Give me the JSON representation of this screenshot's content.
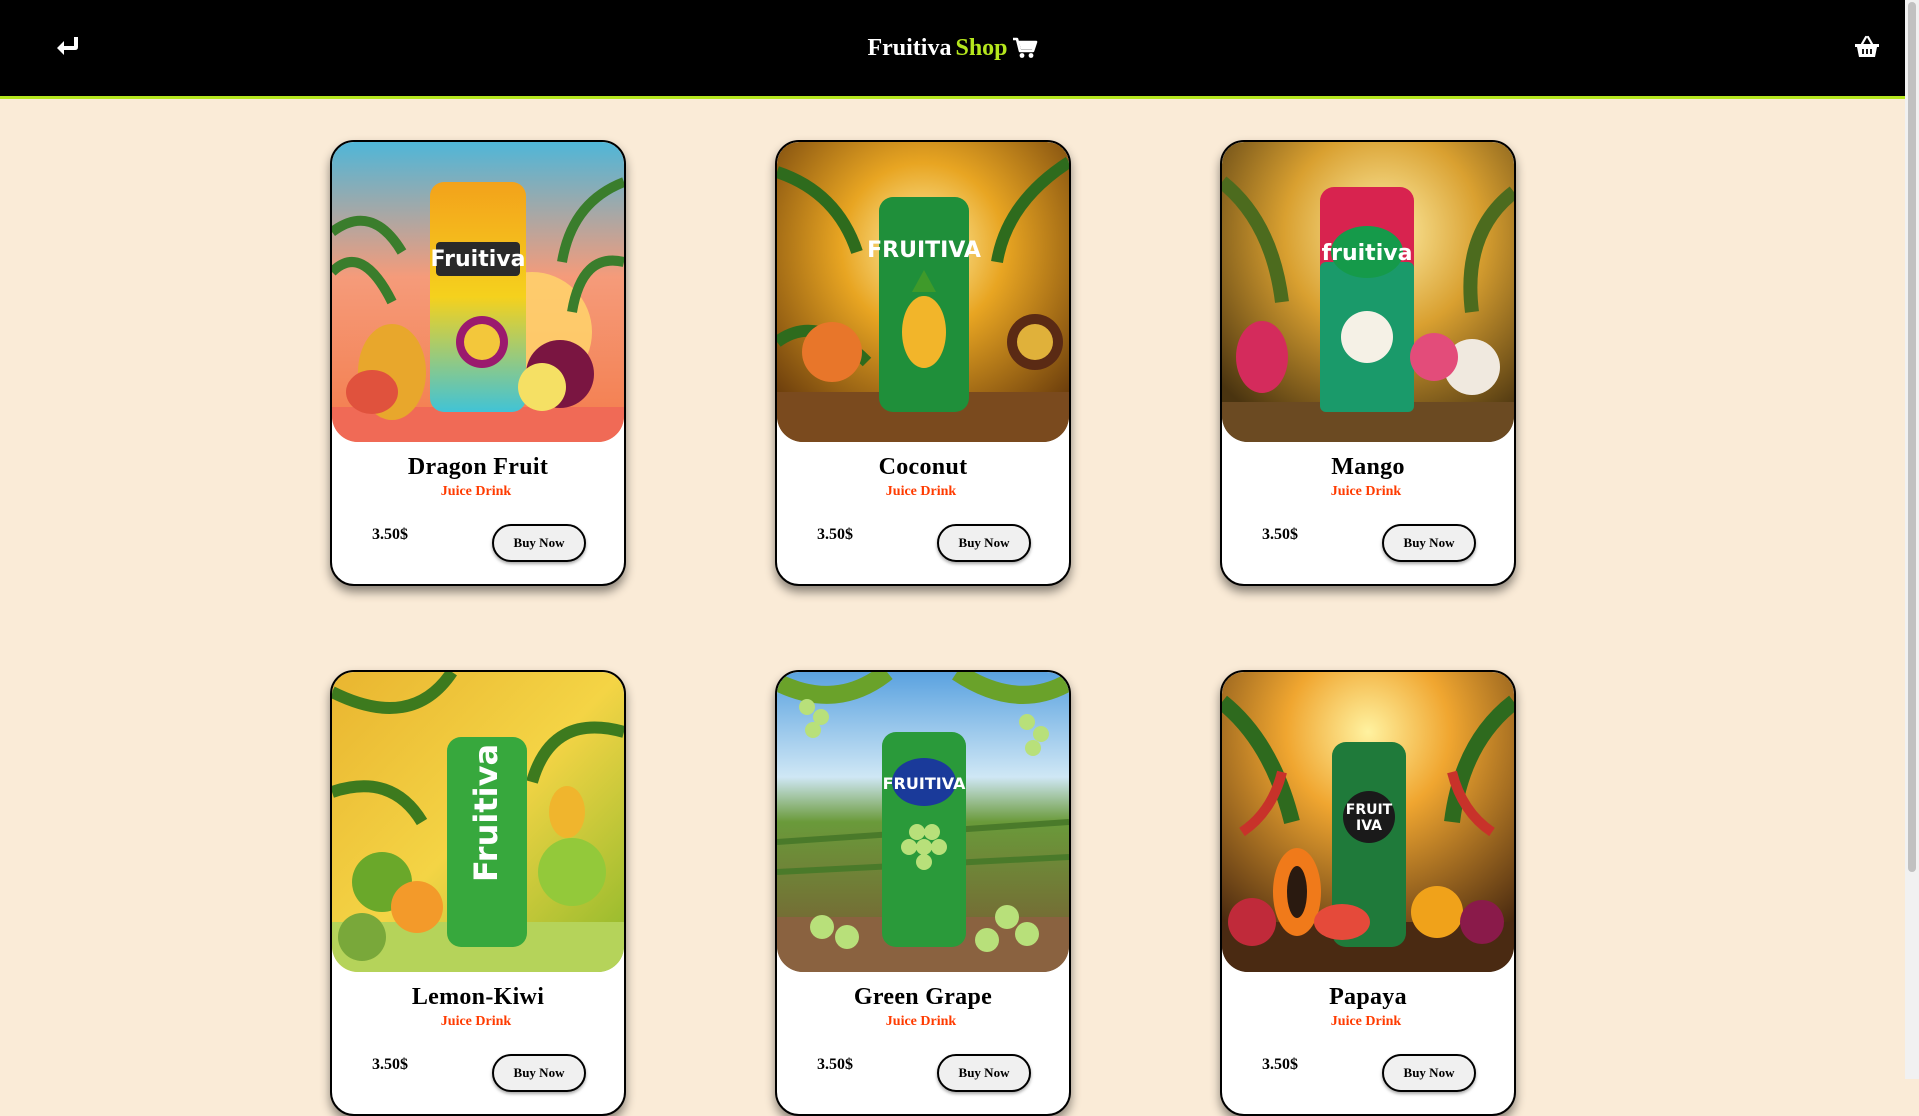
{
  "header": {
    "brand_main": "Fruitiva",
    "brand_accent": "Shop",
    "back_icon": "return-arrow-icon",
    "cart_icon": "shopping-cart-icon",
    "basket_icon": "basket-icon",
    "bg_color": "#000000",
    "accent_color": "#b5e61d"
  },
  "page": {
    "background": "#faebd7"
  },
  "products": [
    {
      "name": "Dragon Fruit",
      "category": "Juice Drink",
      "price": "3.50$",
      "button": "Buy Now",
      "theme": "tropical-sunset"
    },
    {
      "name": "Coconut",
      "category": "Juice Drink",
      "price": "3.50$",
      "button": "Buy Now",
      "theme": "golden-jungle"
    },
    {
      "name": "Mango",
      "category": "Juice Drink",
      "price": "3.50$",
      "button": "Buy Now",
      "theme": "amber-palms"
    },
    {
      "name": "Lemon-Kiwi",
      "category": "Juice Drink",
      "price": "3.50$",
      "button": "Buy Now",
      "theme": "lime-citrus"
    },
    {
      "name": "Green Grape",
      "category": "Juice Drink",
      "price": "3.50$",
      "button": "Buy Now",
      "theme": "vineyard"
    },
    {
      "name": "Papaya",
      "category": "Juice Drink",
      "price": "3.50$",
      "button": "Buy Now",
      "theme": "papaya-jungle"
    }
  ]
}
